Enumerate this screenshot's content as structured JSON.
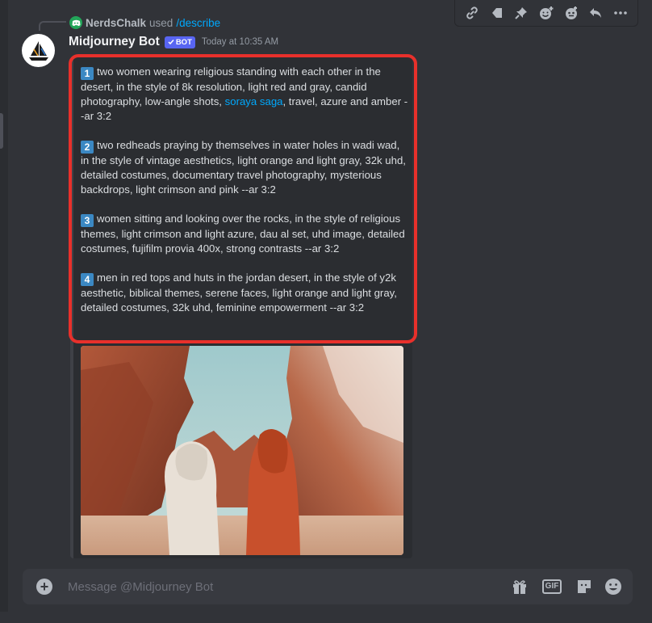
{
  "reply": {
    "user": "NerdsChalk",
    "used": "used",
    "command": "/describe"
  },
  "message": {
    "author": "Midjourney Bot",
    "badge": "BOT",
    "timestamp": "Today at 10:35 AM"
  },
  "description": {
    "items": [
      {
        "num": "1",
        "before": "two women wearing religious standing with each other in the desert, in the style of 8k resolution, light red and gray, candid photography, low-angle shots, ",
        "link": "soraya saga",
        "after": ", travel, azure and amber --ar 3:2"
      },
      {
        "num": "2",
        "text": "two redheads praying by themselves in water holes in wadi wad, in the style of vintage aesthetics, light orange and light gray, 32k uhd, detailed costumes, documentary travel photography, mysterious backdrops, light crimson and pink --ar 3:2"
      },
      {
        "num": "3",
        "text": "women sitting and looking over the rocks, in the style of religious themes, light crimson and light azure, dau al set, uhd image, detailed costumes, fujifilm provia 400x, strong contrasts --ar 3:2"
      },
      {
        "num": "4",
        "text": "men in red tops and huts in the jordan desert, in the style of y2k aesthetic, biblical themes, serene faces, light orange and light gray, detailed costumes, 32k uhd, feminine empowerment --ar 3:2"
      }
    ]
  },
  "composer": {
    "placeholder": "Message @Midjourney Bot",
    "gif_label": "GIF"
  },
  "toolbar_icons": [
    "link-icon",
    "tag-icon",
    "pin-icon",
    "add-reaction-icon",
    "apps-icon",
    "reply-icon",
    "more-icon"
  ],
  "colors": {
    "background": "#313338",
    "embed": "#2b2d31",
    "highlight": "#e8302b",
    "link": "#00a8fc",
    "badge": "#5865f2",
    "number_key": "#3b88c3"
  }
}
